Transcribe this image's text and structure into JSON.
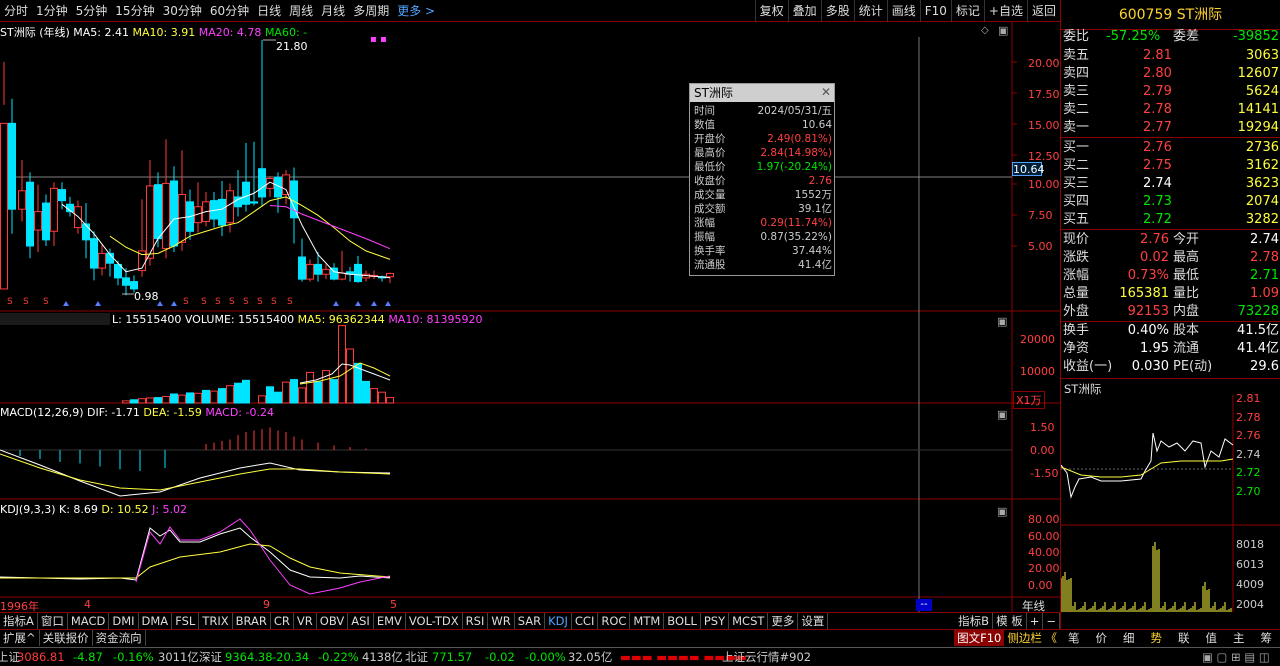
{
  "toolbar": {
    "periods": [
      "分时",
      "1分钟",
      "5分钟",
      "15分钟",
      "30分钟",
      "60分钟",
      "日线",
      "周线",
      "月线",
      "多周期"
    ],
    "more": "更多 >",
    "right": [
      "复权",
      "叠加",
      "多股",
      "统计",
      "画线",
      "F10",
      "标记",
      "+自选",
      "返回"
    ]
  },
  "main": {
    "title": "ST洲际 (年线)",
    "ma5": "MA5: 2.41",
    "ma10": "MA10: 3.91",
    "ma20": "MA20: 4.78",
    "ma60": "MA60: -",
    "peak": "21.80",
    "low": "0.98",
    "cross_price": "10.64",
    "axis": [
      "20.00",
      "17.50",
      "15.00",
      "12.50",
      "10.00",
      "7.50",
      "5.00"
    ]
  },
  "vol": {
    "label": "L: 15515400",
    "volume": "VOLUME: 15515400",
    "ma5": "MA5: 96362344",
    "ma10": "MA10: 81395920",
    "axis": [
      "20000",
      "10000"
    ],
    "unit": "X1万"
  },
  "macd": {
    "label": "MACD(12,26,9)",
    "dif": "DIF: -1.71",
    "dea": "DEA: -1.59",
    "macd": "MACD: -0.24",
    "axis": [
      "1.50",
      "0.00",
      "-1.50"
    ]
  },
  "kdj": {
    "label": "KDJ(9,3,3)",
    "k": "K: 8.69",
    "d": "D: 10.52",
    "j": "J: 5.02",
    "axis": [
      "80.00",
      "60.00",
      "40.00",
      "20.00",
      "0.00"
    ]
  },
  "xaxis": {
    "y1996": "1996年",
    "m4": "4",
    "m9": "9",
    "m5": "5",
    "dash": "--",
    "period": "年线"
  },
  "tooltip": {
    "title": "ST洲际",
    "rows": [
      {
        "k": "时间",
        "v": "2024/05/31/五",
        "c": "#ccc"
      },
      {
        "k": "数值",
        "v": "10.64",
        "c": "#ccc"
      },
      {
        "k": "开盘价",
        "v": "2.49(0.81%)",
        "c": "#ff4040"
      },
      {
        "k": "最高价",
        "v": "2.84(14.98%)",
        "c": "#ff4040"
      },
      {
        "k": "最低价",
        "v": "1.97(-20.24%)",
        "c": "#00e600"
      },
      {
        "k": "收盘价",
        "v": "2.76",
        "c": "#ff4040"
      },
      {
        "k": "成交量",
        "v": "1552万",
        "c": "#ccc"
      },
      {
        "k": "成交额",
        "v": "39.1亿",
        "c": "#ccc"
      },
      {
        "k": "涨幅",
        "v": "0.29(11.74%)",
        "c": "#ff4040"
      },
      {
        "k": "振幅",
        "v": "0.87(35.22%)",
        "c": "#ccc"
      },
      {
        "k": "换手率",
        "v": "37.44%",
        "c": "#ccc"
      },
      {
        "k": "流通股",
        "v": "41.4亿",
        "c": "#ccc"
      }
    ]
  },
  "quote": {
    "header": "600759 ST洲际",
    "wb_label": "委比",
    "wb": "-57.25%",
    "wc_label": "委差",
    "wc": "-39852",
    "asks": [
      {
        "l": "卖五",
        "p": "2.81",
        "v": "3063"
      },
      {
        "l": "卖四",
        "p": "2.80",
        "v": "12607"
      },
      {
        "l": "卖三",
        "p": "2.79",
        "v": "5624"
      },
      {
        "l": "卖二",
        "p": "2.78",
        "v": "14141"
      },
      {
        "l": "卖一",
        "p": "2.77",
        "v": "19294"
      }
    ],
    "bids": [
      {
        "l": "买一",
        "p": "2.76",
        "v": "2736"
      },
      {
        "l": "买二",
        "p": "2.75",
        "v": "3162"
      },
      {
        "l": "买三",
        "p": "2.74",
        "v": "3623"
      },
      {
        "l": "买四",
        "p": "2.73",
        "v": "2074"
      },
      {
        "l": "买五",
        "p": "2.72",
        "v": "3282"
      }
    ],
    "stats": [
      {
        "a": "现价",
        "av": "2.76",
        "ac": "#ff4040",
        "b": "今开",
        "bv": "2.74",
        "bc": "#fff"
      },
      {
        "a": "涨跌",
        "av": "0.02",
        "ac": "#ff4040",
        "b": "最高",
        "bv": "2.78",
        "bc": "#ff4040"
      },
      {
        "a": "涨幅",
        "av": "0.73%",
        "ac": "#ff4040",
        "b": "最低",
        "bv": "2.71",
        "bc": "#00e600"
      },
      {
        "a": "总量",
        "av": "165381",
        "ac": "#ffff40",
        "b": "量比",
        "bv": "1.09",
        "bc": "#ff4040"
      },
      {
        "a": "外盘",
        "av": "92153",
        "ac": "#ff4040",
        "b": "内盘",
        "bv": "73228",
        "bc": "#00e600"
      }
    ],
    "stats2": [
      {
        "a": "换手",
        "av": "0.40%",
        "b": "股本",
        "bv": "41.5亿"
      },
      {
        "a": "净资",
        "av": "1.95",
        "b": "流通",
        "bv": "41.4亿"
      },
      {
        "a": "收益(一)",
        "av": "0.030",
        "b": "PE(动)",
        "bv": "29.6"
      }
    ],
    "mini_title": "ST洲际",
    "mini_axis": [
      "2.81",
      "2.78",
      "2.76",
      "2.74",
      "2.72",
      "2.70"
    ],
    "mini_vol": [
      "8018",
      "6013",
      "4009",
      "2004"
    ]
  },
  "btabs": [
    "指标A",
    "窗口",
    "MACD",
    "DMI",
    "DMA",
    "FSL",
    "TRIX",
    "BRAR",
    "CR",
    "VR",
    "OBV",
    "ASI",
    "EMV",
    "VOL-TDX",
    "RSI",
    "WR",
    "SAR",
    "KDJ",
    "CCI",
    "ROC",
    "MTM",
    "BOLL",
    "PSY",
    "MCST",
    "更多",
    "设置"
  ],
  "btabs_right": [
    "指标B",
    "模 板",
    "+",
    "−"
  ],
  "strip": [
    "扩展^",
    "关联报价",
    "资金流向"
  ],
  "strip_right": {
    "f10": "图文F10",
    "side": "侧边栏 《",
    "tabs": [
      "笔",
      "价",
      "细",
      "势",
      "联",
      "值",
      "主",
      "筹"
    ]
  },
  "status": {
    "sh": "上证",
    "sh_v": "3086.81",
    "sh_c": "-4.87",
    "sh_p": "-0.16%",
    "sh_a": "3011亿",
    "sz": "深证",
    "sz_v": "9364.38",
    "sz_c": "-20.34",
    "sz_p": "-0.22%",
    "sz_a": "4138亿",
    "bz": "北证",
    "bz_v": "771.57",
    "bz_c": "-0.02",
    "bz_p": "-0.00%",
    "bz_a": "32.05亿",
    "news": "上证云行情#902"
  }
}
